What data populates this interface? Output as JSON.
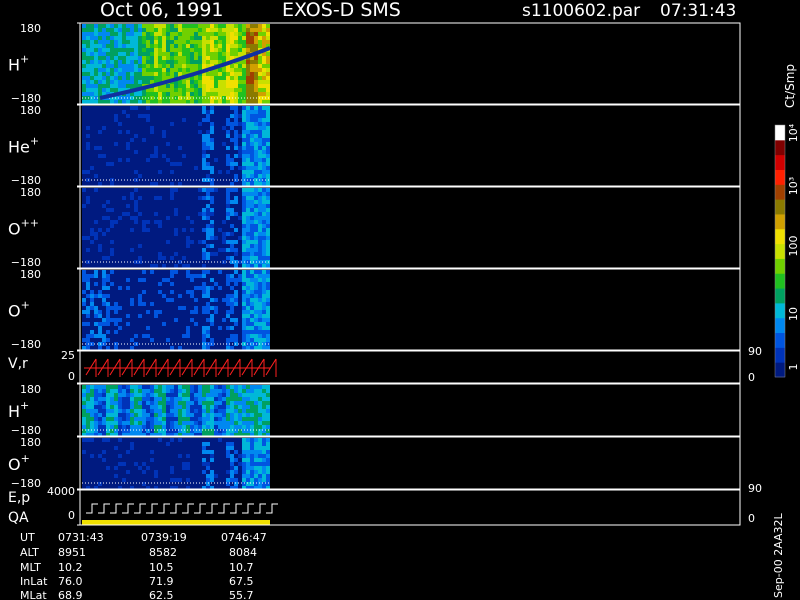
{
  "header": {
    "date": "Oct 06, 1991",
    "instrument": "EXOS-D SMS",
    "file": "s1100602.par",
    "time": "07:31:43"
  },
  "colorbar": {
    "unit": "Ct/Smp",
    "scale": "log",
    "tick_labels": [
      "1",
      "10",
      "100",
      "10³",
      "10⁴"
    ],
    "colors": [
      "#001a80",
      "#0033b8",
      "#0055e0",
      "#0088f0",
      "#00b8d8",
      "#00a060",
      "#20c020",
      "#70d000",
      "#c8e000",
      "#f0e000",
      "#d0a000",
      "#8a7a00",
      "#a04000",
      "#ff2000",
      "#d00000",
      "#800000",
      "#ffffff"
    ]
  },
  "chart_data": [
    {
      "type": "heatmap",
      "panel": "H+",
      "species": "H",
      "superscript": "+",
      "ylim": [
        -180,
        180
      ],
      "ytick_labels": [
        "180",
        "−180"
      ]
    },
    {
      "type": "heatmap",
      "panel": "He+",
      "species": "He",
      "superscript": "+",
      "ylim": [
        -180,
        180
      ],
      "ytick_labels": [
        "180",
        "−180"
      ]
    },
    {
      "type": "heatmap",
      "panel": "O++",
      "species": "O",
      "superscript": "++",
      "ylim": [
        -180,
        180
      ],
      "ytick_labels": [
        "180",
        "−180"
      ]
    },
    {
      "type": "heatmap",
      "panel": "O+",
      "species": "O",
      "superscript": "+",
      "ylim": [
        -180,
        180
      ],
      "ytick_labels": [
        "180",
        "−180"
      ]
    },
    {
      "type": "line",
      "panel": "V,r",
      "label": "V,r",
      "ylim": [
        0,
        25
      ],
      "ytick_labels": [
        "25",
        "0"
      ],
      "right_ytick_labels": [
        "90",
        "0"
      ],
      "color": "#ff2020"
    },
    {
      "type": "heatmap",
      "panel": "H+ (2)",
      "species": "H",
      "superscript": "+",
      "ylim": [
        -180,
        180
      ],
      "ytick_labels": [
        "180",
        "−180"
      ]
    },
    {
      "type": "heatmap",
      "panel": "O+ (2)",
      "species": "O",
      "superscript": "+",
      "ylim": [
        -180,
        180
      ],
      "ytick_labels": [
        "180",
        "−180"
      ]
    },
    {
      "type": "line",
      "panel": "E,p / QA",
      "label1": "E,p",
      "label2": "QA",
      "ylim": [
        0,
        4000
      ],
      "ytick_labels": [
        "4000",
        "0"
      ],
      "right_ytick_labels": [
        "90",
        "0"
      ],
      "color": "#ffffff",
      "qa_color": "#f0e000"
    }
  ],
  "orbit_table": {
    "row_labels": [
      "UT",
      "ALT",
      "MLT",
      "InLat",
      "MLat"
    ],
    "columns": [
      [
        "0731:43",
        "8951",
        "10.2",
        "76.0",
        "68.9"
      ],
      [
        "0739:19",
        "8582",
        "10.5",
        "71.9",
        "62.5"
      ],
      [
        "0746:47",
        "8084",
        "10.7",
        "67.5",
        "55.7"
      ]
    ]
  },
  "footer_note": "Sep-00 2AA32L"
}
